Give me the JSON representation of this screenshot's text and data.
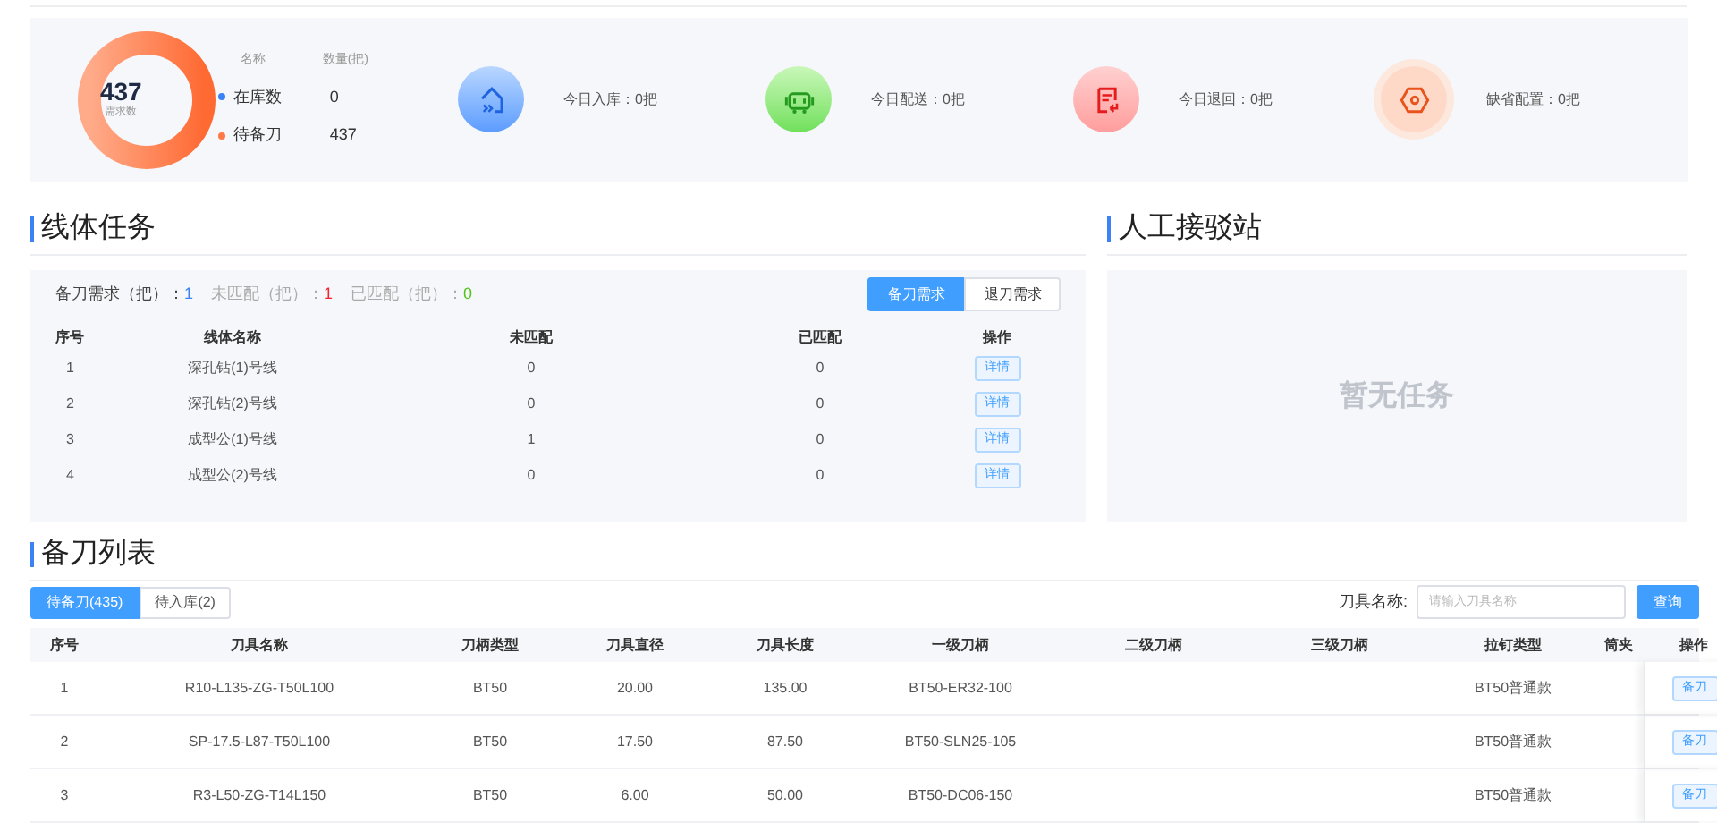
{
  "summary": {
    "total": "437",
    "total_label": "需求数",
    "legend_header": [
      "名称",
      "数量(把)"
    ],
    "legend": [
      {
        "name": "在库数",
        "value": "0",
        "color": "#3b82f6"
      },
      {
        "name": "待备刀",
        "value": "437",
        "color": "#ff7a45"
      }
    ],
    "stats": [
      {
        "kind": "inbound",
        "label": "今日入库：0把"
      },
      {
        "kind": "delivery",
        "label": "今日配送：0把"
      },
      {
        "kind": "return",
        "label": "今日退回：0把"
      },
      {
        "kind": "default",
        "label": "缺省配置：0把"
      }
    ]
  },
  "line_tasks": {
    "title": "线体任务",
    "counts": [
      {
        "label": "备刀需求（把）：",
        "value": "1",
        "color": "#3b82f6"
      },
      {
        "label": "未匹配（把）：",
        "value": "1",
        "color": "#f5222d"
      },
      {
        "label": "已匹配（把）：",
        "value": "0",
        "color": "#52c41a"
      }
    ],
    "tabs": [
      {
        "label": "备刀需求",
        "selected": true
      },
      {
        "label": "退刀需求",
        "selected": false
      }
    ],
    "columns": [
      "序号",
      "线体名称",
      "未匹配",
      "已匹配",
      "操作"
    ],
    "rows": [
      {
        "no": "1",
        "name": "深孔钻(1)号线",
        "unmatched": "0",
        "matched": "0",
        "action": "详情"
      },
      {
        "no": "2",
        "name": "深孔钻(2)号线",
        "unmatched": "0",
        "matched": "0",
        "action": "详情"
      },
      {
        "no": "3",
        "name": "成型公(1)号线",
        "unmatched": "1",
        "matched": "0",
        "action": "详情"
      },
      {
        "no": "4",
        "name": "成型公(2)号线",
        "unmatched": "0",
        "matched": "0",
        "action": "详情"
      }
    ]
  },
  "manual_station": {
    "title": "人工接驳站",
    "empty": "暂无任务"
  },
  "tool_list": {
    "title": "备刀列表",
    "tabs": [
      {
        "label": "待备刀(435)",
        "selected": true
      },
      {
        "label": "待入库(2)",
        "selected": false
      }
    ],
    "search": {
      "label": "刀具名称:",
      "placeholder": "请输入刀具名称",
      "button": "查询"
    },
    "columns": [
      "序号",
      "刀具名称",
      "刀柄类型",
      "刀具直径",
      "刀具长度",
      "一级刀柄",
      "二级刀柄",
      "三级刀柄",
      "拉钉类型",
      "筒夹",
      "操作"
    ],
    "rows": [
      {
        "cells": [
          "1",
          "R10-L135-ZG-T50L100",
          "BT50",
          "20.00",
          "135.00",
          "BT50-ER32-100",
          "",
          "",
          "BT50普通款",
          ""
        ],
        "action": "备刀"
      },
      {
        "cells": [
          "2",
          "SP-17.5-L87-T50L100",
          "BT50",
          "17.50",
          "87.50",
          "BT50-SLN25-105",
          "",
          "",
          "BT50普通款",
          ""
        ],
        "action": "备刀"
      },
      {
        "cells": [
          "3",
          "R3-L50-ZG-T14L150",
          "BT50",
          "6.00",
          "50.00",
          "BT50-DC06-150",
          "",
          "",
          "BT50普通款",
          ""
        ],
        "action": "备刀"
      }
    ]
  }
}
